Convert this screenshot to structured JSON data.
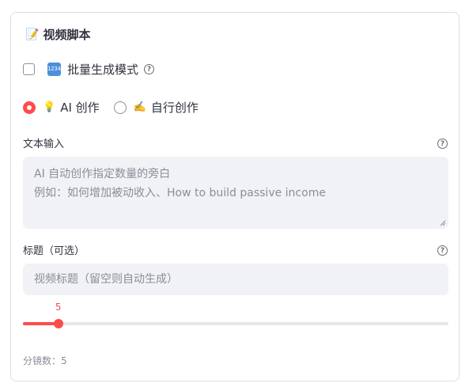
{
  "section": {
    "title": "视频脚本",
    "title_emoji": "📝"
  },
  "batch_mode": {
    "label": "批量生成模式",
    "badge": "1234",
    "checked": false
  },
  "mode": {
    "options": [
      {
        "emoji": "💡",
        "label": "AI 创作",
        "selected": true
      },
      {
        "emoji": "✍️",
        "label": "自行创作",
        "selected": false
      }
    ]
  },
  "text_input": {
    "label": "文本输入",
    "placeholder_line1": "AI 自动创作指定数量的旁白",
    "placeholder_line2": "例如：如何增加被动收入、How to build passive income"
  },
  "title_input": {
    "label": "标题（可选）",
    "placeholder": "视频标题（留空则自动生成）"
  },
  "slider": {
    "value": "5",
    "min": 1,
    "max": 100,
    "fraction": 0.083
  },
  "segments_caption": "分镜数：5",
  "colors": {
    "accent": "#ff4b4b",
    "input_bg": "#f0f2f6"
  }
}
